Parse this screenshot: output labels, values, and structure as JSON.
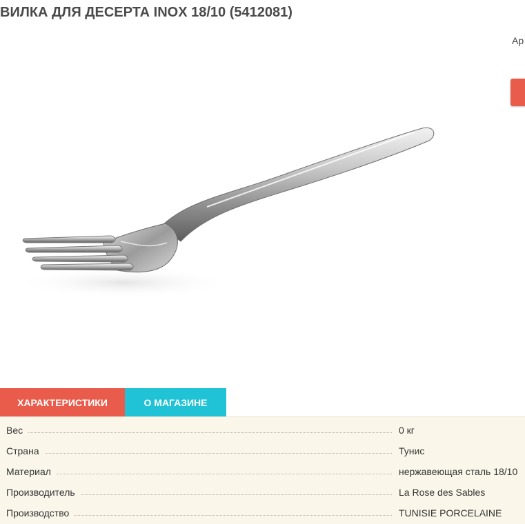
{
  "product": {
    "title": "ВИЛКА ДЛЯ ДЕСЕРТА INOX 18/10 (5412081)",
    "sku_label": "Ар"
  },
  "image": {
    "subject": "dessert fork"
  },
  "tabs": [
    {
      "label": "ХАРАКТЕРИСТИКИ",
      "active": true,
      "color": "#e95c4b"
    },
    {
      "label": "О МАГАЗИНЕ",
      "active": false,
      "color": "#1fc3d5"
    }
  ],
  "specs": [
    {
      "label": "Вес",
      "value": "0 кг"
    },
    {
      "label": "Страна",
      "value": "Тунис"
    },
    {
      "label": "Материал",
      "value": "нержавеющая сталь 18/10"
    },
    {
      "label": "Производитель",
      "value": "La Rose des Sables"
    },
    {
      "label": "Производство",
      "value": "TUNISIE PORCELAINE"
    }
  ],
  "colors": {
    "accent_red": "#e95c4b",
    "accent_cyan": "#1fc3d5",
    "spec_background": "#faf6ea"
  }
}
